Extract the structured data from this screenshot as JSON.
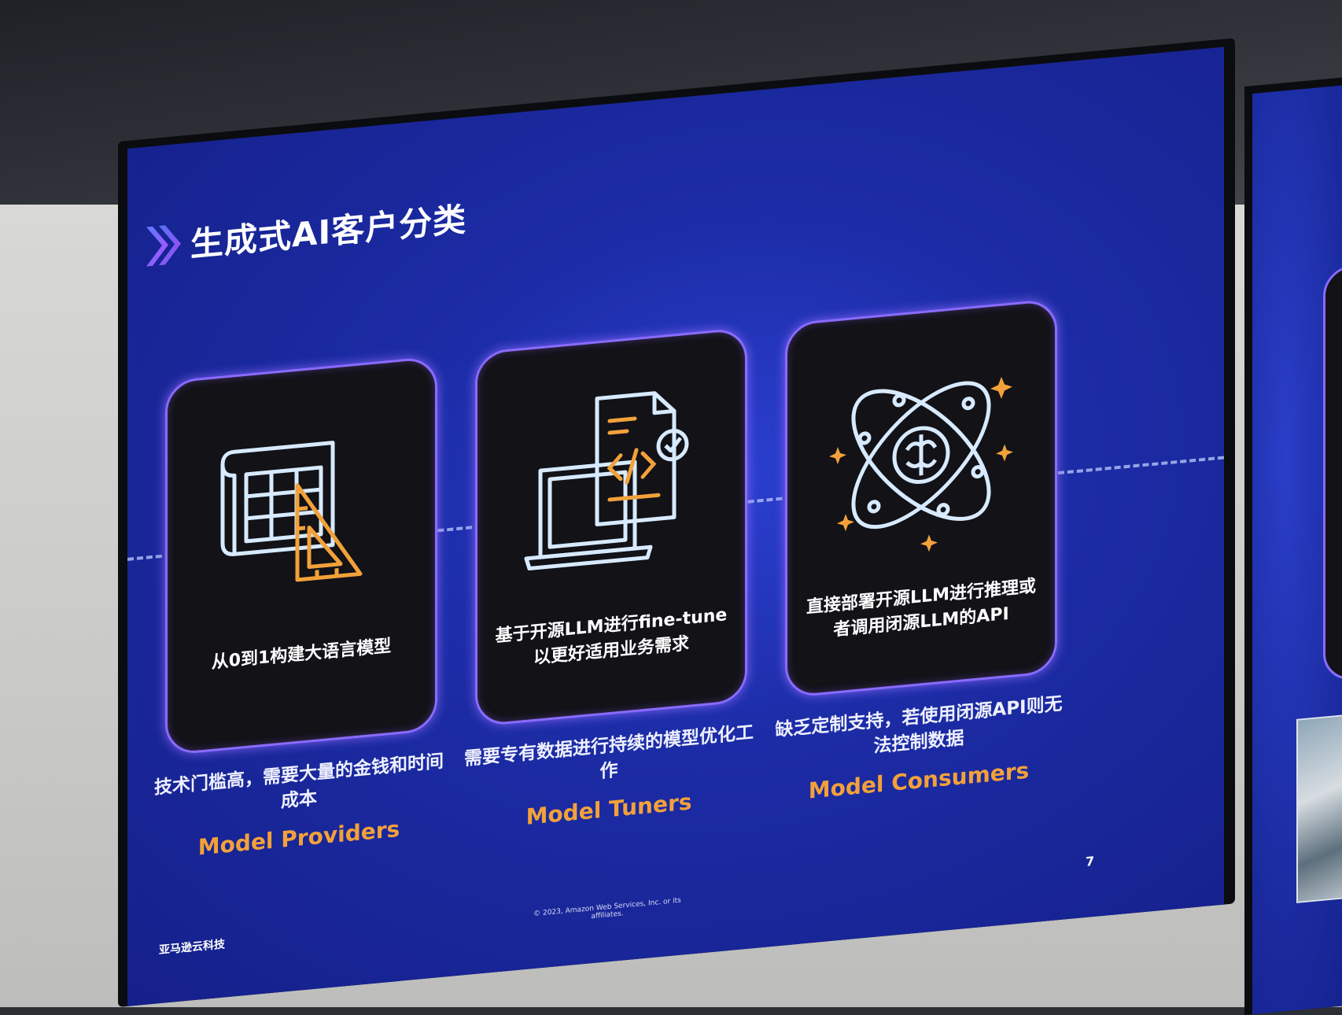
{
  "slide": {
    "title": "生成式AI客户分类",
    "page_number": "7",
    "footer_logo": "亚马逊云科技",
    "footer_copyright": "© 2023, Amazon Web Services, Inc. or its affiliates."
  },
  "cards": [
    {
      "icon": "blueprint-ruler-icon",
      "card_text": "从0到1构建大语言模型",
      "description": "技术门槛高，需要大量的金钱和时间成本",
      "role": "Model Providers"
    },
    {
      "icon": "laptop-code-document-icon",
      "card_text": "基于开源LLM进行fine-tune以更好适用业务需求",
      "description": "需要专有数据进行持续的模型优化工作",
      "role": "Model Tuners"
    },
    {
      "icon": "brain-orbit-icon",
      "card_text": "直接部署开源LLM进行推理或者调用闭源LLM的API",
      "description": "缺乏定制支持，若使用闭源API则无法控制数据",
      "role": "Model Consumers"
    }
  ],
  "colors": {
    "slide_background": "#1c2ca6",
    "card_border": "#8a6bff",
    "card_fill": "#121217",
    "role_text": "#f2a13a",
    "icon_line": "#d7eaff",
    "icon_accent": "#f2a13a"
  }
}
